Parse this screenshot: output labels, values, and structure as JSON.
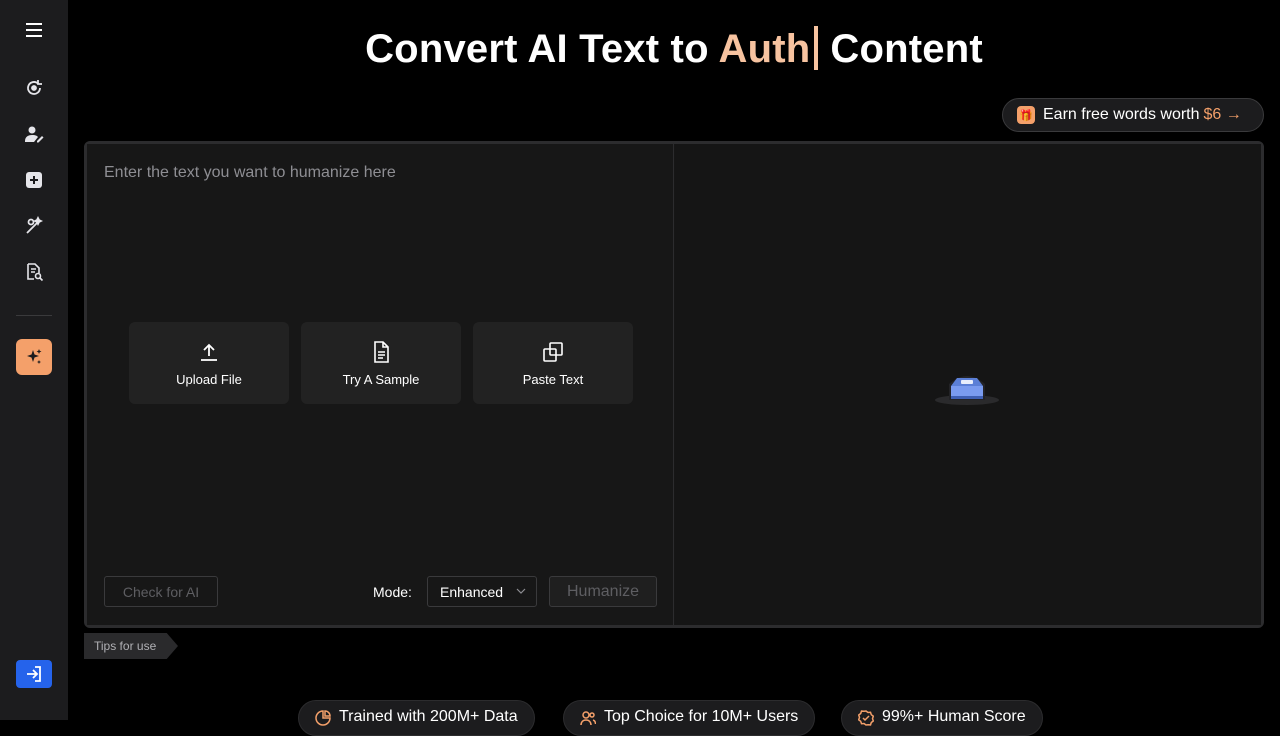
{
  "sidebar": {
    "items": [
      {
        "icon": "menu-icon"
      },
      {
        "icon": "refresh-eye-icon"
      },
      {
        "icon": "user-edit-icon"
      },
      {
        "icon": "plus-square-icon"
      },
      {
        "icon": "magic-wand-icon"
      },
      {
        "icon": "doc-search-icon"
      },
      {
        "icon": "sparkles-icon"
      },
      {
        "icon": "login-icon"
      }
    ]
  },
  "header": {
    "title_before": "Convert AI Text to ",
    "title_typed": "Auth",
    "title_after": "Content"
  },
  "promo": {
    "label": "Earn free words worth",
    "amount": "$6 →"
  },
  "editor": {
    "placeholder": "Enter the text you want to humanize here",
    "actions": [
      {
        "label": "Upload File"
      },
      {
        "label": "Try A Sample"
      },
      {
        "label": "Paste Text"
      }
    ],
    "check_label": "Check for AI",
    "mode_label": "Mode:",
    "mode_value": "Enhanced",
    "humanize_label": "Humanize"
  },
  "tips_label": "Tips for use",
  "badges": [
    {
      "label": "Trained with 200M+ Data"
    },
    {
      "label": "Top Choice for 10M+ Users"
    },
    {
      "label": "99%+ Human Score"
    }
  ],
  "colors": {
    "accent": "#f4a06a",
    "accent_light": "#f7c3a0",
    "login": "#2563eb"
  }
}
